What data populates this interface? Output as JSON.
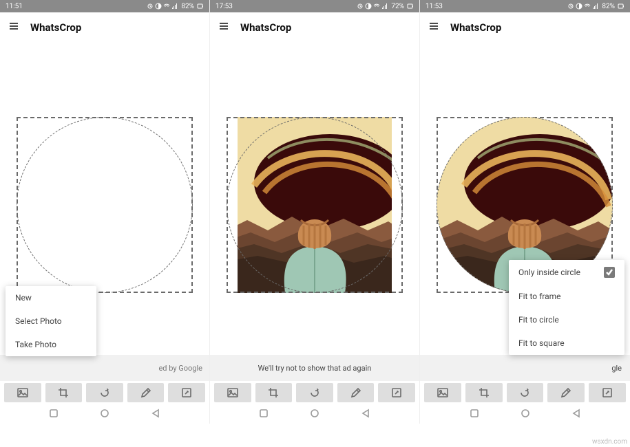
{
  "panels": [
    {
      "status": {
        "time": "11:51",
        "battery": "82%"
      },
      "title": "WhatsCrop",
      "ad_text": "ed by Google",
      "popup_open": "new-menu"
    },
    {
      "status": {
        "time": "17:53",
        "battery": "72%"
      },
      "title": "WhatsCrop",
      "ad_text": "We'll try not to show that ad again",
      "popup_open": null
    },
    {
      "status": {
        "time": "11:53",
        "battery": "82%"
      },
      "title": "WhatsCrop",
      "ad_text": "gle",
      "popup_open": "fit-menu"
    }
  ],
  "menus": {
    "new": {
      "items": [
        "New",
        "Select Photo",
        "Take Photo"
      ]
    },
    "fit": {
      "items": [
        {
          "label": "Only inside circle",
          "checked": true
        },
        {
          "label": "Fit to frame"
        },
        {
          "label": "Fit to circle"
        },
        {
          "label": "Fit to square"
        }
      ]
    }
  },
  "toolbar_icons": [
    "image-icon",
    "crop-icon",
    "rotate-icon",
    "pencil-icon",
    "edit-box-icon"
  ],
  "nav_icons": [
    "square-icon",
    "circle-icon",
    "triangle-icon"
  ],
  "watermark": "wsxdn.com"
}
